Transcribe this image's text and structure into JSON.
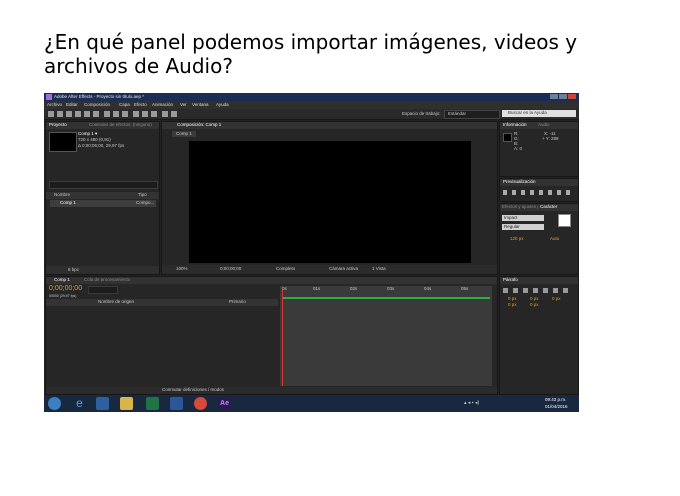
{
  "question": {
    "line1": "¿En qué panel podemos importar imágenes, videos y",
    "line2": "archivos de Audio?"
  },
  "screenshot": {
    "window_title": "Adobe After Effects - Proyecto sin título.aep *",
    "menu": [
      "Archivo",
      "Editar",
      "Composición",
      "Capa",
      "Efecto",
      "Animación",
      "Ver",
      "Ventana",
      "Ayuda"
    ],
    "workspace_label": "Espacio de trabajo:",
    "workspace_value": "Estándar",
    "search_placeholder": "Buscar en la Ayuda",
    "project_tab": "Proyecto",
    "effects_tab": "Controles de efectos: (ninguno)",
    "comp_item": "Comp 1 ▾",
    "comp_info1": "720 x 480 (0,91)",
    "comp_info2": "Δ 0;00;05;00, 29,97 fps",
    "col_name": "Nombre",
    "col_type": "Tipo",
    "row_name": "Comp 1",
    "row_type": "Compo...",
    "bpc": "8 bpc",
    "viewer_tab": "Composición: Comp 1",
    "viewer_sub": "Comp 1",
    "zoom": "100%",
    "timecode_small": "0;00;00;00",
    "resolution": "Completo",
    "camera": "Cámara activa",
    "views": "1 Vista",
    "info_tab": "Información",
    "audio_tab": "Audio",
    "info_r": "R:",
    "info_g": "G:",
    "info_b": "B:",
    "info_a": "A: 0",
    "info_x": "X: -11",
    "info_y": "+ Y: 288",
    "preview_tab": "Previsualización",
    "effects_presets_tab": "Efectos y ajustes preestablecidos",
    "char_tab": "Carácter",
    "font_name": "Impact",
    "font_style": "Regular",
    "font_size": "120 px",
    "kerning": "Auto",
    "paragraph_tab": "Párrafo",
    "para_vals": [
      "0 px",
      "0 px",
      "0 px",
      "0 px",
      "0 px"
    ],
    "timeline_tab": "Comp 1",
    "render_tab": "Cola de procesamiento",
    "timecode": "0;00;00;00",
    "timecode_sub": "00000 (29,97 fps)",
    "layer_col": "Nombre de origen",
    "parent_col": "Primario",
    "ruler": [
      "0s",
      "01s",
      "02s",
      "03s",
      "04s",
      "05s"
    ],
    "toggle_label": "Conmutar definiciones / modos",
    "clock_time": "09:43 p.m.",
    "clock_date": "01/04/2016",
    "taskbar_ae": "Ae"
  },
  "colors": {
    "titlebar": "#1b2d52",
    "taskbar": "#17283f",
    "timecode": "#e5a21c",
    "workarea": "#2fae3a",
    "playhead": "#dd3333"
  }
}
